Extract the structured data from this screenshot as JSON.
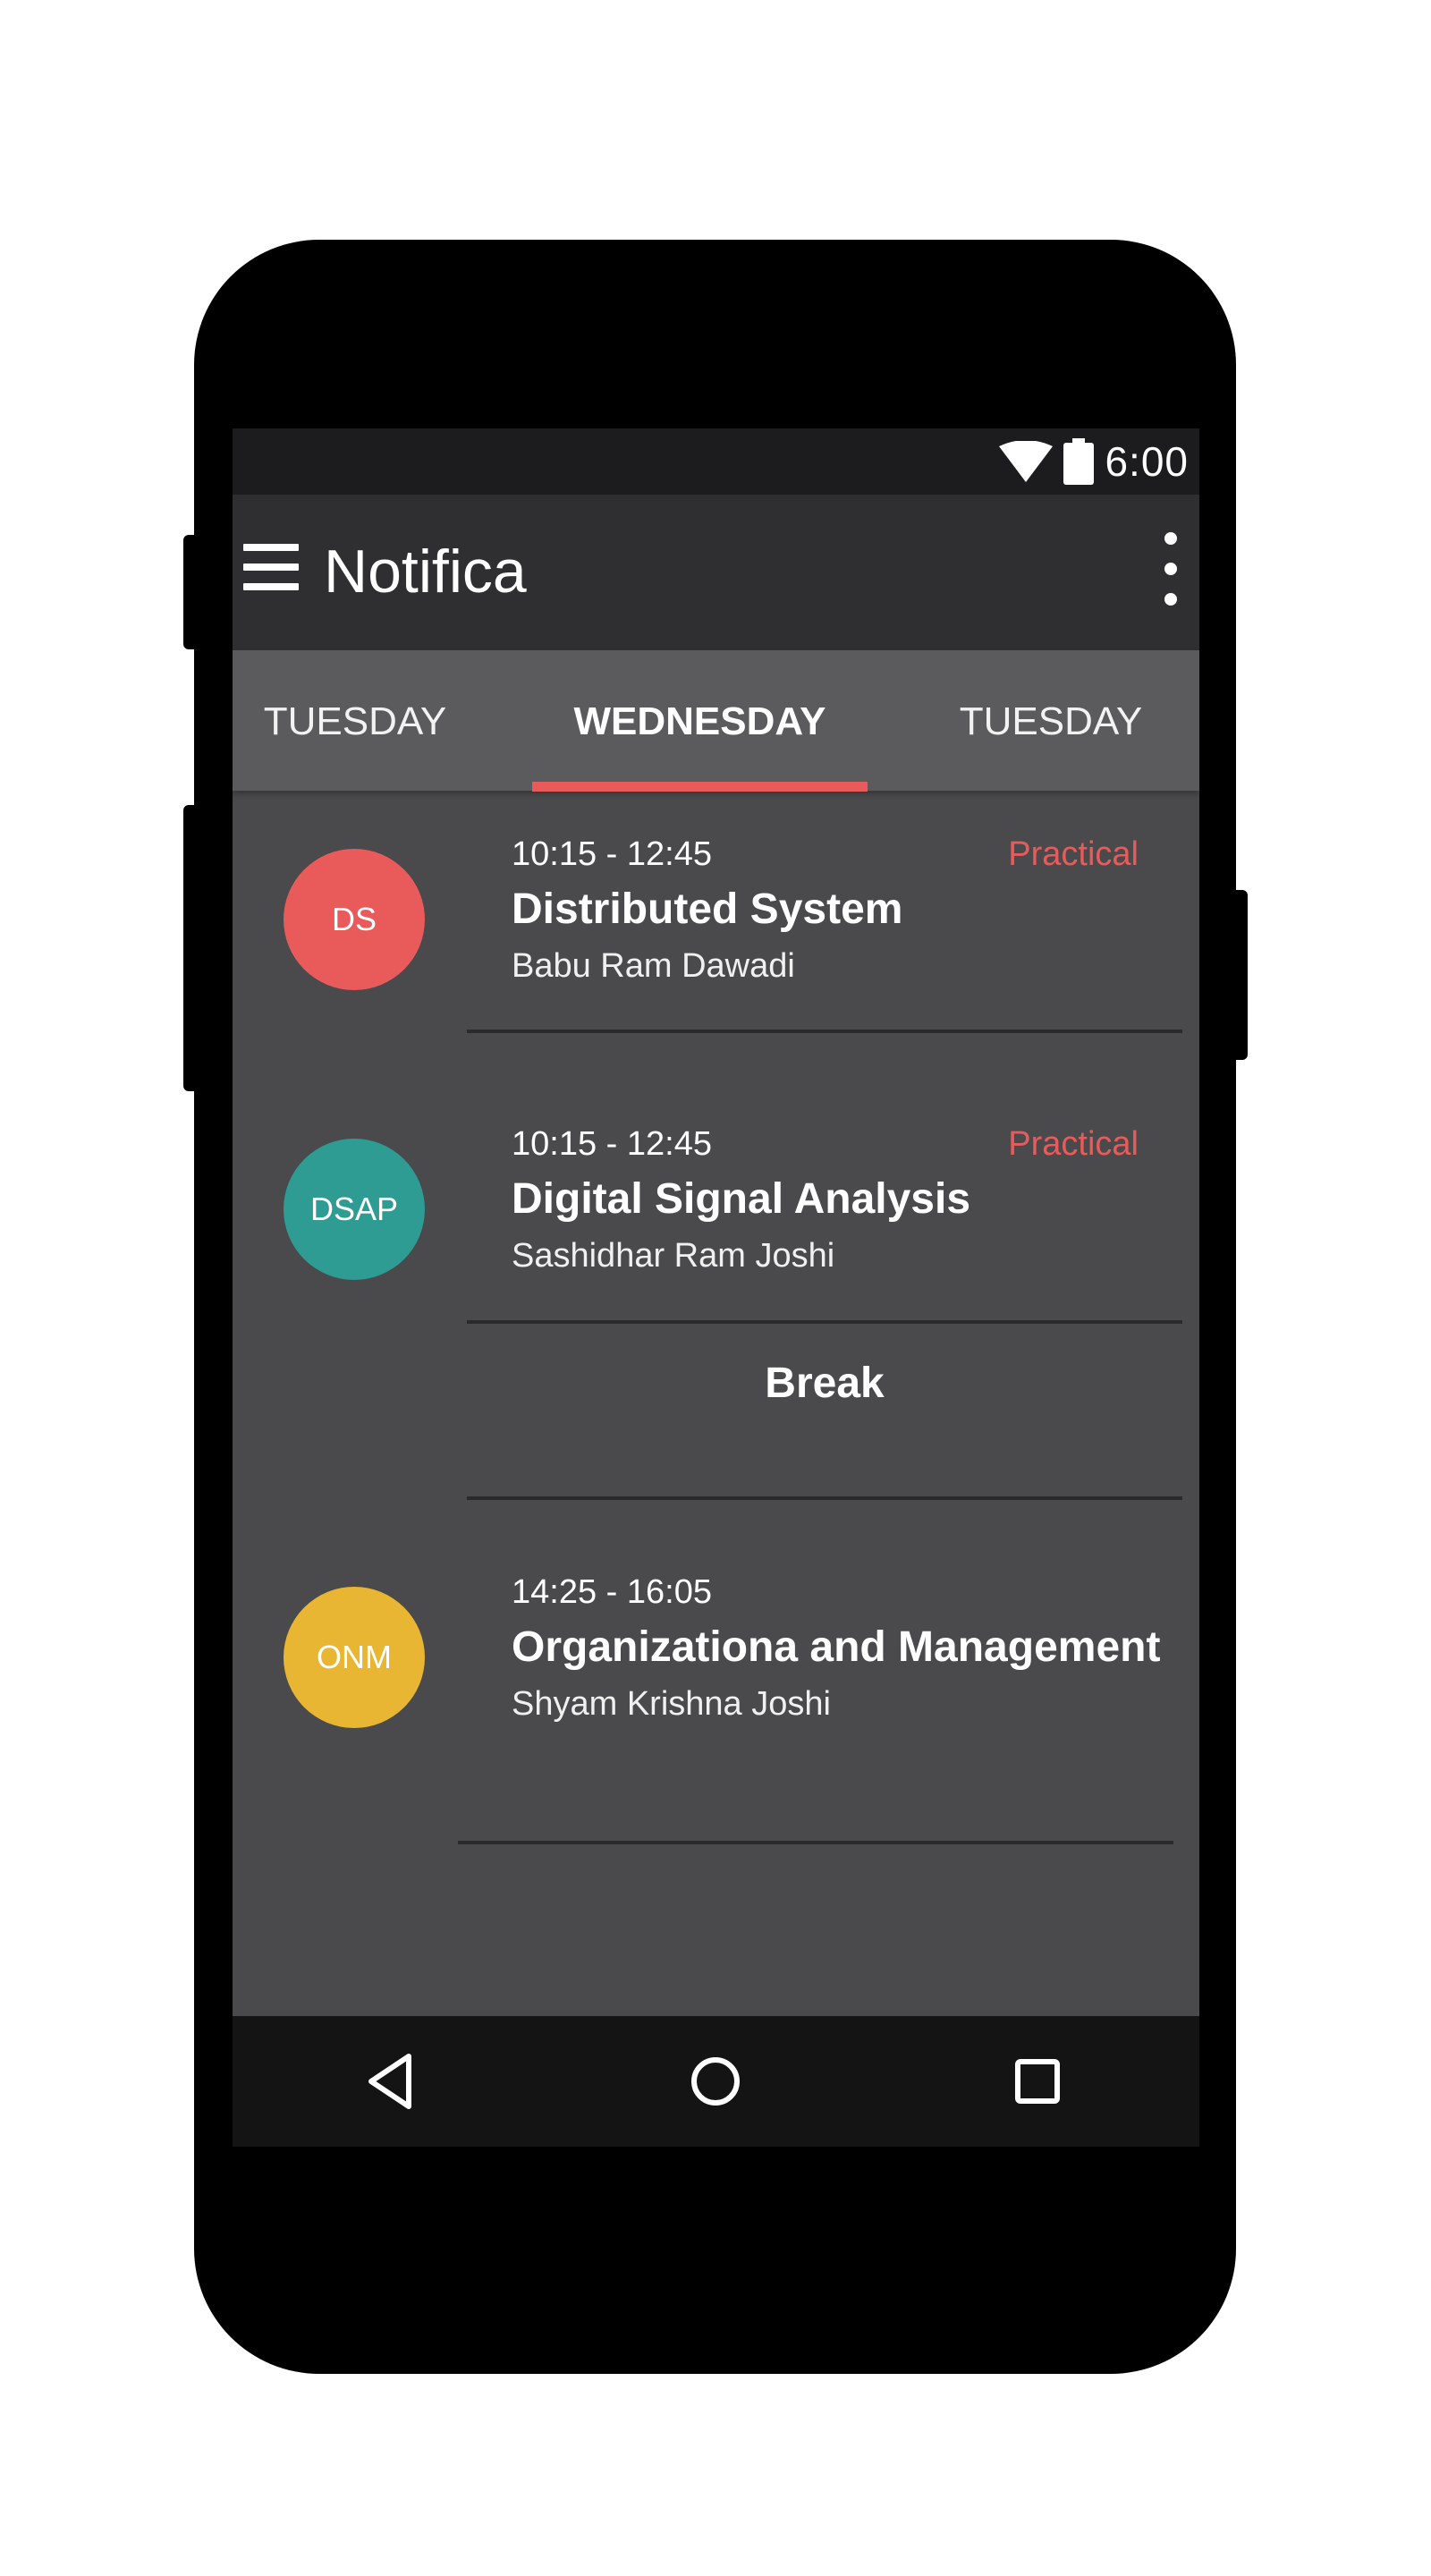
{
  "status_bar": {
    "time": "6:00",
    "icons": [
      "wifi-icon",
      "battery-icon"
    ]
  },
  "app_bar": {
    "title": "Notifica",
    "icons": [
      "menu-icon",
      "overflow-menu-icon"
    ]
  },
  "tabs": [
    {
      "label": "TUESDAY",
      "selected": false
    },
    {
      "label": "WEDNESDAY",
      "selected": true
    },
    {
      "label": "TUESDAY",
      "selected": false
    }
  ],
  "schedule": [
    {
      "badge": "DS",
      "badge_color": "#e95a5a",
      "time": "10:15 - 12:45",
      "tag": "Practical",
      "subject": "Distributed System",
      "teacher": "Babu Ram Dawadi"
    },
    {
      "badge": "DSAP",
      "badge_color": "#2e9c93",
      "time": "10:15 - 12:45",
      "tag": "Practical",
      "subject": "Digital Signal Analysis",
      "teacher": "Sashidhar Ram Joshi"
    },
    {
      "break_label": "Break"
    },
    {
      "badge": "ONM",
      "badge_color": "#e8b632",
      "time": "14:25 - 16:05",
      "tag": "",
      "subject": "Organizationa and Management",
      "teacher": "Shyam Krishna Joshi"
    }
  ],
  "nav_bar": {
    "icons": [
      "back-icon",
      "home-icon",
      "recents-icon"
    ]
  },
  "colors": {
    "accent": "#e95a5a",
    "screen_bg": "#4a4a4c",
    "app_bar_bg": "#2f2f31",
    "tabs_bg": "#5b5b5d"
  }
}
